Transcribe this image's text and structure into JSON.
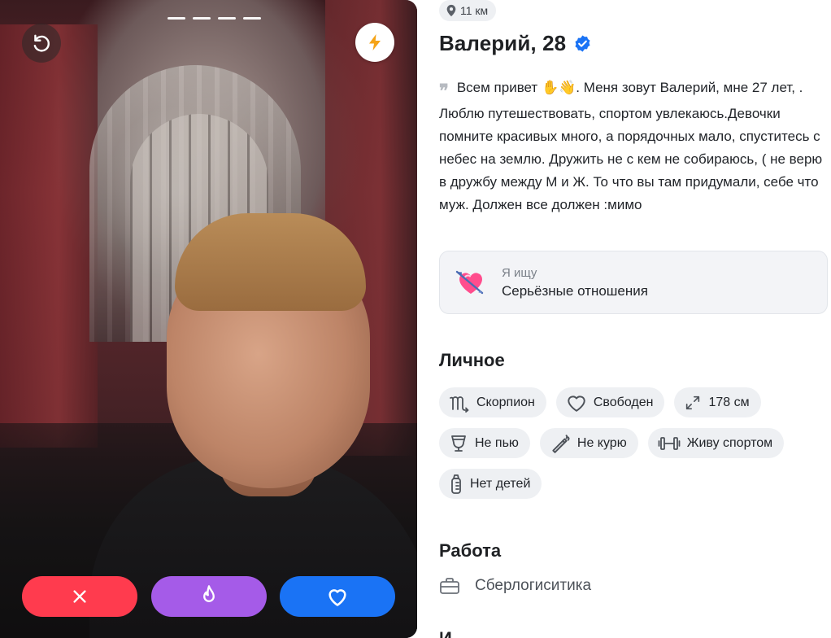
{
  "photo": {
    "progress_segments": 4,
    "actions": {
      "dislike_color": "#ff3b4e",
      "superlike_color": "#a55be8",
      "like_color": "#1a73f5"
    }
  },
  "profile": {
    "distance": "11 км",
    "name_age": "Валерий, 28",
    "verified": true,
    "bio": "Всем привет ✋👋. Меня зовут Валерий, мне 27 лет, . Люблю путешествовать, спортом увлекаюсь.Девочки помните красивых много, а порядочных мало, спуститесь с небес на землю. Дружить не с кем не собираюсь, ( не верю в дружбу между М и Ж. То что вы там придумали, себе что муж. Должен все должен :мимо",
    "seeking": {
      "label": "Я ищу",
      "value": "Серьёзные отношения"
    },
    "personal": {
      "title": "Личное",
      "tags": [
        {
          "icon": "scorpio-icon",
          "label": "Скорпион"
        },
        {
          "icon": "heart-icon",
          "label": "Свободен"
        },
        {
          "icon": "height-icon",
          "label": "178 см"
        },
        {
          "icon": "glass-icon",
          "label": "Не пью"
        },
        {
          "icon": "cigarette-icon",
          "label": "Не курю"
        },
        {
          "icon": "dumbbell-icon",
          "label": "Живу спортом"
        },
        {
          "icon": "baby-bottle-icon",
          "label": "Нет детей"
        }
      ]
    },
    "work": {
      "title": "Работа",
      "value": "Сберлогиситика"
    }
  }
}
